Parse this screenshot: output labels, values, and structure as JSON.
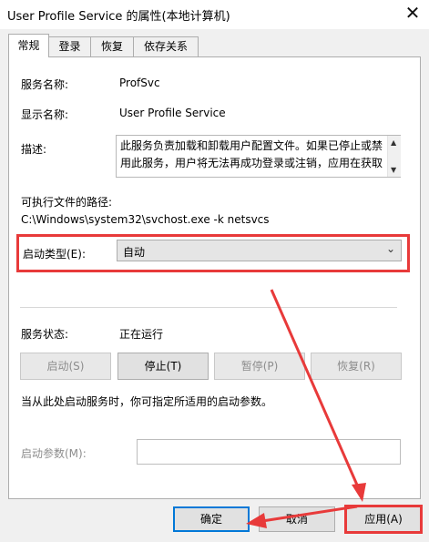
{
  "window": {
    "title": "User Profile Service 的属性(本地计算机)",
    "close_glyph": "✕"
  },
  "tabs": [
    {
      "label": "常规",
      "active": true
    },
    {
      "label": "登录",
      "active": false
    },
    {
      "label": "恢复",
      "active": false
    },
    {
      "label": "依存关系",
      "active": false
    }
  ],
  "general": {
    "service_name_label": "服务名称:",
    "service_name": "ProfSvc",
    "display_name_label": "显示名称:",
    "display_name": "User Profile Service",
    "description_label": "描述:",
    "description": "此服务负责加载和卸载用户配置文件。如果已停止或禁用此服务，用户将无法再成功登录或注销，应用在获取",
    "exe_path_label": "可执行文件的路径:",
    "exe_path": "C:\\Windows\\system32\\svchost.exe -k netsvcs",
    "startup_type_label": "启动类型(E):",
    "startup_type_value": "自动",
    "status_label": "服务状态:",
    "status_value": "正在运行",
    "buttons": {
      "start": "启动(S)",
      "stop": "停止(T)",
      "pause": "暂停(P)",
      "resume": "恢复(R)"
    },
    "hint": "当从此处启动服务时，你可指定所适用的启动参数。",
    "start_params_label": "启动参数(M):",
    "start_params_value": ""
  },
  "dialog_buttons": {
    "ok": "确定",
    "cancel": "取消",
    "apply": "应用(A)"
  },
  "icons": {
    "scroll_up": "▲",
    "scroll_down": "▼",
    "dropdown": "⌄"
  },
  "colors": {
    "annotation_red": "#e83a3a",
    "focus_blue": "#0078d7"
  }
}
